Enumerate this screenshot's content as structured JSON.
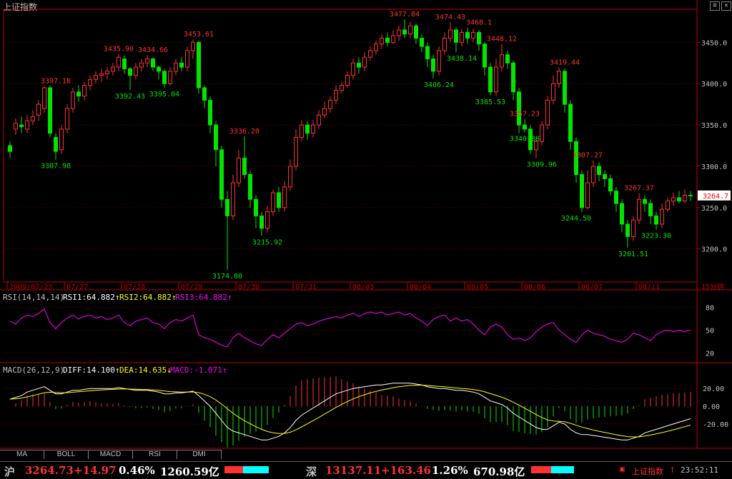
{
  "window": {
    "title": "上证指数"
  },
  "chart_data": {
    "type": "candlestick",
    "title": "上证指数",
    "period": "15分钟",
    "ylim": [
      3160,
      3490
    ],
    "yticks": [
      3200.0,
      3250.0,
      3300.0,
      3350.0,
      3400.0,
      3450.0
    ],
    "current_price": "3264.7",
    "date_labels": [
      "2009/07/23",
      "07/27",
      "07/28",
      "07/29",
      "07/30",
      "07/31",
      "08/03",
      "08/04",
      "08/05",
      "08/06",
      "08/07",
      "08/11"
    ],
    "annotations": [
      {
        "text": "3397.18",
        "color": "red",
        "x": 8,
        "y": 3397.18
      },
      {
        "text": "3307.98",
        "color": "green",
        "x": 8,
        "y": 3307.98
      },
      {
        "text": "3435.90",
        "color": "red",
        "x": 19,
        "y": 3435.9
      },
      {
        "text": "3434.66",
        "color": "red",
        "x": 25,
        "y": 3434.66
      },
      {
        "text": "3392.43",
        "color": "green",
        "x": 21,
        "y": 3392.43
      },
      {
        "text": "3395.04",
        "color": "green",
        "x": 27,
        "y": 3395.04
      },
      {
        "text": "3453.61",
        "color": "red",
        "x": 33,
        "y": 3453.61
      },
      {
        "text": "3336.20",
        "color": "red",
        "x": 41,
        "y": 3336.2
      },
      {
        "text": "3174.80",
        "color": "green",
        "x": 38,
        "y": 3174.8
      },
      {
        "text": "3215.92",
        "color": "green",
        "x": 45,
        "y": 3215.92
      },
      {
        "text": "3477.84",
        "color": "red",
        "x": 69,
        "y": 3477.84
      },
      {
        "text": "3406.24",
        "color": "green",
        "x": 75,
        "y": 3406.24
      },
      {
        "text": "3474.43",
        "color": "red",
        "x": 77,
        "y": 3474.43
      },
      {
        "text": "3468.1",
        "color": "red",
        "x": 82,
        "y": 3468.1
      },
      {
        "text": "3438.14",
        "color": "green",
        "x": 79,
        "y": 3438.14
      },
      {
        "text": "3448.12",
        "color": "red",
        "x": 86,
        "y": 3448.12
      },
      {
        "text": "3385.53",
        "color": "green",
        "x": 84,
        "y": 3385.53
      },
      {
        "text": "3357.23",
        "color": "red",
        "x": 90,
        "y": 3357.23
      },
      {
        "text": "3340.88",
        "color": "green",
        "x": 90,
        "y": 3340.88
      },
      {
        "text": "3419.44",
        "color": "red",
        "x": 97,
        "y": 3419.44
      },
      {
        "text": "3309.96",
        "color": "green",
        "x": 93,
        "y": 3309.96
      },
      {
        "text": "3307.27",
        "color": "red",
        "x": 101,
        "y": 3307.27
      },
      {
        "text": "3244.50",
        "color": "green",
        "x": 99,
        "y": 3244.5
      },
      {
        "text": "3267.37",
        "color": "red",
        "x": 110,
        "y": 3267.37
      },
      {
        "text": "3201.51",
        "color": "green",
        "x": 109,
        "y": 3201.51
      },
      {
        "text": "3223.30",
        "color": "green",
        "x": 113,
        "y": 3223.3
      }
    ],
    "candles": [
      [
        3325,
        3318,
        3330,
        3310
      ],
      [
        3345,
        3352,
        3358,
        3338
      ],
      [
        3350,
        3348,
        3360,
        3340
      ],
      [
        3345,
        3355,
        3362,
        3340
      ],
      [
        3355,
        3360,
        3368,
        3350
      ],
      [
        3362,
        3375,
        3380,
        3355
      ],
      [
        3370,
        3395,
        3397.18,
        3365
      ],
      [
        3395,
        3340,
        3398,
        3335
      ],
      [
        3335,
        3318,
        3340,
        3307.98
      ],
      [
        3320,
        3345,
        3350,
        3315
      ],
      [
        3345,
        3370,
        3375,
        3340
      ],
      [
        3370,
        3390,
        3395,
        3365
      ],
      [
        3390,
        3385,
        3398,
        3378
      ],
      [
        3385,
        3398,
        3402,
        3380
      ],
      [
        3398,
        3405,
        3410,
        3392
      ],
      [
        3405,
        3410,
        3415,
        3400
      ],
      [
        3410,
        3412,
        3418,
        3402
      ],
      [
        3412,
        3415,
        3420,
        3405
      ],
      [
        3415,
        3420,
        3425,
        3410
      ],
      [
        3420,
        3432,
        3435.9,
        3415
      ],
      [
        3430,
        3418,
        3434,
        3412
      ],
      [
        3418,
        3410,
        3420,
        3392.43
      ],
      [
        3410,
        3420,
        3425,
        3405
      ],
      [
        3420,
        3425,
        3430,
        3415
      ],
      [
        3425,
        3430,
        3434.66,
        3420
      ],
      [
        3430,
        3420,
        3432,
        3415
      ],
      [
        3420,
        3415,
        3422,
        3405
      ],
      [
        3415,
        3400,
        3418,
        3395.04
      ],
      [
        3400,
        3415,
        3420,
        3398
      ],
      [
        3415,
        3425,
        3430,
        3410
      ],
      [
        3425,
        3420,
        3432,
        3415
      ],
      [
        3420,
        3440,
        3445,
        3415
      ],
      [
        3440,
        3450,
        3453.61,
        3430
      ],
      [
        3450,
        3395,
        3452,
        3388
      ],
      [
        3395,
        3380,
        3398,
        3370
      ],
      [
        3380,
        3350,
        3385,
        3340
      ],
      [
        3350,
        3320,
        3355,
        3300
      ],
      [
        3320,
        3260,
        3325,
        3250
      ],
      [
        3260,
        3240,
        3270,
        3174.8
      ],
      [
        3240,
        3280,
        3290,
        3235
      ],
      [
        3280,
        3310,
        3320,
        3275
      ],
      [
        3310,
        3290,
        3336.2,
        3285
      ],
      [
        3290,
        3260,
        3295,
        3250
      ],
      [
        3260,
        3240,
        3265,
        3225
      ],
      [
        3240,
        3225,
        3245,
        3215.92
      ],
      [
        3225,
        3245,
        3252,
        3220
      ],
      [
        3245,
        3268,
        3272,
        3240
      ],
      [
        3268,
        3250,
        3275,
        3245
      ],
      [
        3250,
        3275,
        3282,
        3245
      ],
      [
        3275,
        3300,
        3308,
        3270
      ],
      [
        3300,
        3335,
        3345,
        3295
      ],
      [
        3335,
        3350,
        3356,
        3330
      ],
      [
        3350,
        3340,
        3355,
        3332
      ],
      [
        3340,
        3350,
        3356,
        3335
      ],
      [
        3350,
        3362,
        3368,
        3345
      ],
      [
        3362,
        3370,
        3378,
        3358
      ],
      [
        3370,
        3380,
        3385,
        3365
      ],
      [
        3380,
        3392,
        3398,
        3375
      ],
      [
        3392,
        3398,
        3402,
        3388
      ],
      [
        3398,
        3410,
        3415,
        3395
      ],
      [
        3410,
        3425,
        3430,
        3405
      ],
      [
        3425,
        3420,
        3432,
        3412
      ],
      [
        3420,
        3432,
        3438,
        3415
      ],
      [
        3432,
        3440,
        3445,
        3428
      ],
      [
        3440,
        3448,
        3452,
        3435
      ],
      [
        3448,
        3455,
        3460,
        3442
      ],
      [
        3455,
        3450,
        3462,
        3445
      ],
      [
        3450,
        3458,
        3465,
        3448
      ],
      [
        3458,
        3465,
        3470,
        3452
      ],
      [
        3465,
        3460,
        3477.84,
        3455
      ],
      [
        3460,
        3470,
        3475,
        3455
      ],
      [
        3470,
        3455,
        3472,
        3448
      ],
      [
        3455,
        3445,
        3460,
        3438
      ],
      [
        3445,
        3430,
        3450,
        3420
      ],
      [
        3430,
        3415,
        3435,
        3406.24
      ],
      [
        3415,
        3440,
        3445,
        3410
      ],
      [
        3440,
        3455,
        3462,
        3435
      ],
      [
        3455,
        3465,
        3474.43,
        3450
      ],
      [
        3465,
        3450,
        3468,
        3438.14
      ],
      [
        3450,
        3462,
        3466,
        3445
      ],
      [
        3462,
        3455,
        3468.1,
        3448
      ],
      [
        3455,
        3462,
        3466,
        3450
      ],
      [
        3462,
        3448,
        3465,
        3440
      ],
      [
        3448,
        3420,
        3450,
        3410
      ],
      [
        3420,
        3390,
        3425,
        3385.53
      ],
      [
        3390,
        3420,
        3430,
        3385
      ],
      [
        3420,
        3435,
        3448.12,
        3415
      ],
      [
        3435,
        3425,
        3440,
        3418
      ],
      [
        3425,
        3390,
        3428,
        3380
      ],
      [
        3390,
        3350,
        3395,
        3340
      ],
      [
        3350,
        3345,
        3357.23,
        3340.88
      ],
      [
        3345,
        3320,
        3350,
        3315
      ],
      [
        3320,
        3330,
        3335,
        3309.96
      ],
      [
        3330,
        3350,
        3355,
        3325
      ],
      [
        3350,
        3380,
        3385,
        3345
      ],
      [
        3380,
        3400,
        3410,
        3375
      ],
      [
        3400,
        3415,
        3419.44,
        3395
      ],
      [
        3415,
        3375,
        3418,
        3365
      ],
      [
        3375,
        3330,
        3380,
        3320
      ],
      [
        3330,
        3290,
        3335,
        3280
      ],
      [
        3290,
        3250,
        3295,
        3244.5
      ],
      [
        3250,
        3280,
        3295,
        3248
      ],
      [
        3280,
        3300,
        3307.27,
        3275
      ],
      [
        3300,
        3290,
        3305,
        3282
      ],
      [
        3290,
        3285,
        3295,
        3275
      ],
      [
        3285,
        3270,
        3290,
        3265
      ],
      [
        3270,
        3255,
        3275,
        3245
      ],
      [
        3255,
        3230,
        3260,
        3220
      ],
      [
        3230,
        3215,
        3235,
        3201.51
      ],
      [
        3215,
        3235,
        3240,
        3210
      ],
      [
        3235,
        3260,
        3267.37,
        3230
      ],
      [
        3260,
        3255,
        3265,
        3245
      ],
      [
        3255,
        3240,
        3260,
        3230
      ],
      [
        3240,
        3230,
        3245,
        3223.3
      ],
      [
        3230,
        3248,
        3255,
        3225
      ],
      [
        3248,
        3258,
        3262,
        3245
      ],
      [
        3258,
        3262,
        3268,
        3252
      ],
      [
        3262,
        3258,
        3270,
        3255
      ],
      [
        3258,
        3265,
        3272,
        3255
      ],
      [
        3265,
        3264.7,
        3270,
        3258
      ]
    ]
  },
  "rsi": {
    "label": "RSI(14,14,14)",
    "rsi1_text": "RSI1:64.882↑",
    "rsi2_text": "RSI2:64.882↑",
    "rsi3_text": "RSI3:64.882↑",
    "yticks": [
      "80",
      "50",
      "20"
    ],
    "values": [
      62,
      58,
      66,
      70,
      68,
      72,
      78,
      60,
      52,
      60,
      66,
      70,
      65,
      68,
      70,
      66,
      68,
      64,
      66,
      70,
      60,
      56,
      62,
      64,
      66,
      60,
      58,
      52,
      60,
      64,
      62,
      66,
      70,
      44,
      40,
      38,
      34,
      30,
      28,
      40,
      46,
      40,
      36,
      32,
      30,
      38,
      44,
      40,
      46,
      52,
      58,
      60,
      56,
      58,
      62,
      64,
      66,
      68,
      66,
      70,
      72,
      68,
      72,
      74,
      72,
      74,
      70,
      72,
      74,
      70,
      72,
      66,
      62,
      56,
      64,
      68,
      70,
      62,
      66,
      62,
      64,
      58,
      50,
      44,
      54,
      58,
      54,
      44,
      38,
      40,
      36,
      40,
      48,
      54,
      58,
      60,
      50,
      44,
      38,
      34,
      44,
      50,
      46,
      44,
      42,
      38,
      36,
      34,
      38,
      46,
      44,
      40,
      36,
      44,
      48,
      50,
      48,
      50,
      48,
      50
    ]
  },
  "macd": {
    "label": "MACD(26,12,9)",
    "diff_text": "DIFF:14.100↑",
    "dea_text": "DEA:14.635↓",
    "macd_text": "MACD:-1.071↑",
    "yticks": [
      "20.00",
      "0.00",
      "-20.00"
    ],
    "diff": [
      8,
      10,
      12,
      16,
      18,
      20,
      22,
      18,
      14,
      14,
      16,
      18,
      18,
      19,
      20,
      20,
      20,
      20,
      20,
      21,
      20,
      19,
      18,
      18,
      18,
      17,
      16,
      14,
      14,
      15,
      15,
      16,
      17,
      12,
      6,
      0,
      -8,
      -16,
      -24,
      -28,
      -30,
      -32,
      -34,
      -36,
      -38,
      -38,
      -36,
      -34,
      -30,
      -24,
      -16,
      -10,
      -6,
      -2,
      2,
      6,
      10,
      14,
      16,
      18,
      20,
      21,
      22,
      23,
      24,
      24,
      25,
      26,
      26,
      26,
      26,
      25,
      24,
      22,
      21,
      20,
      20,
      19,
      18,
      18,
      17,
      16,
      14,
      10,
      6,
      4,
      2,
      -2,
      -8,
      -12,
      -16,
      -20,
      -24,
      -26,
      -26,
      -22,
      -18,
      -20,
      -26,
      -30,
      -32,
      -32,
      -33,
      -34,
      -35,
      -36,
      -37,
      -38,
      -38,
      -36,
      -34,
      -30,
      -28,
      -26,
      -24,
      -22,
      -20,
      -18,
      -16,
      -14
    ]
  },
  "tabs": [
    "MA",
    "BOLL",
    "MACD",
    "RSI",
    "DMI"
  ],
  "status": {
    "sh_label": "沪",
    "sh_price": "3264.73",
    "sh_change": "+14.97",
    "sh_pct": "0.46%",
    "sh_volume": "1260.59亿",
    "sz_label": "深",
    "sz_price": "13137.11",
    "sz_change": "+163.46",
    "sz_pct": "1.26%",
    "sz_volume": "670.98亿",
    "index_name": "上证指数",
    "index_arrow": "↑",
    "clock": "23:52:11"
  },
  "colors": {
    "up": "#ff3232",
    "down": "#00e400",
    "label_red": "#ff3232",
    "label_green": "#00e400",
    "grid": "#800000",
    "axis": "#c00000",
    "rsi": "#ff00ff",
    "diff": "#ffffff",
    "dea": "#ffff00"
  }
}
